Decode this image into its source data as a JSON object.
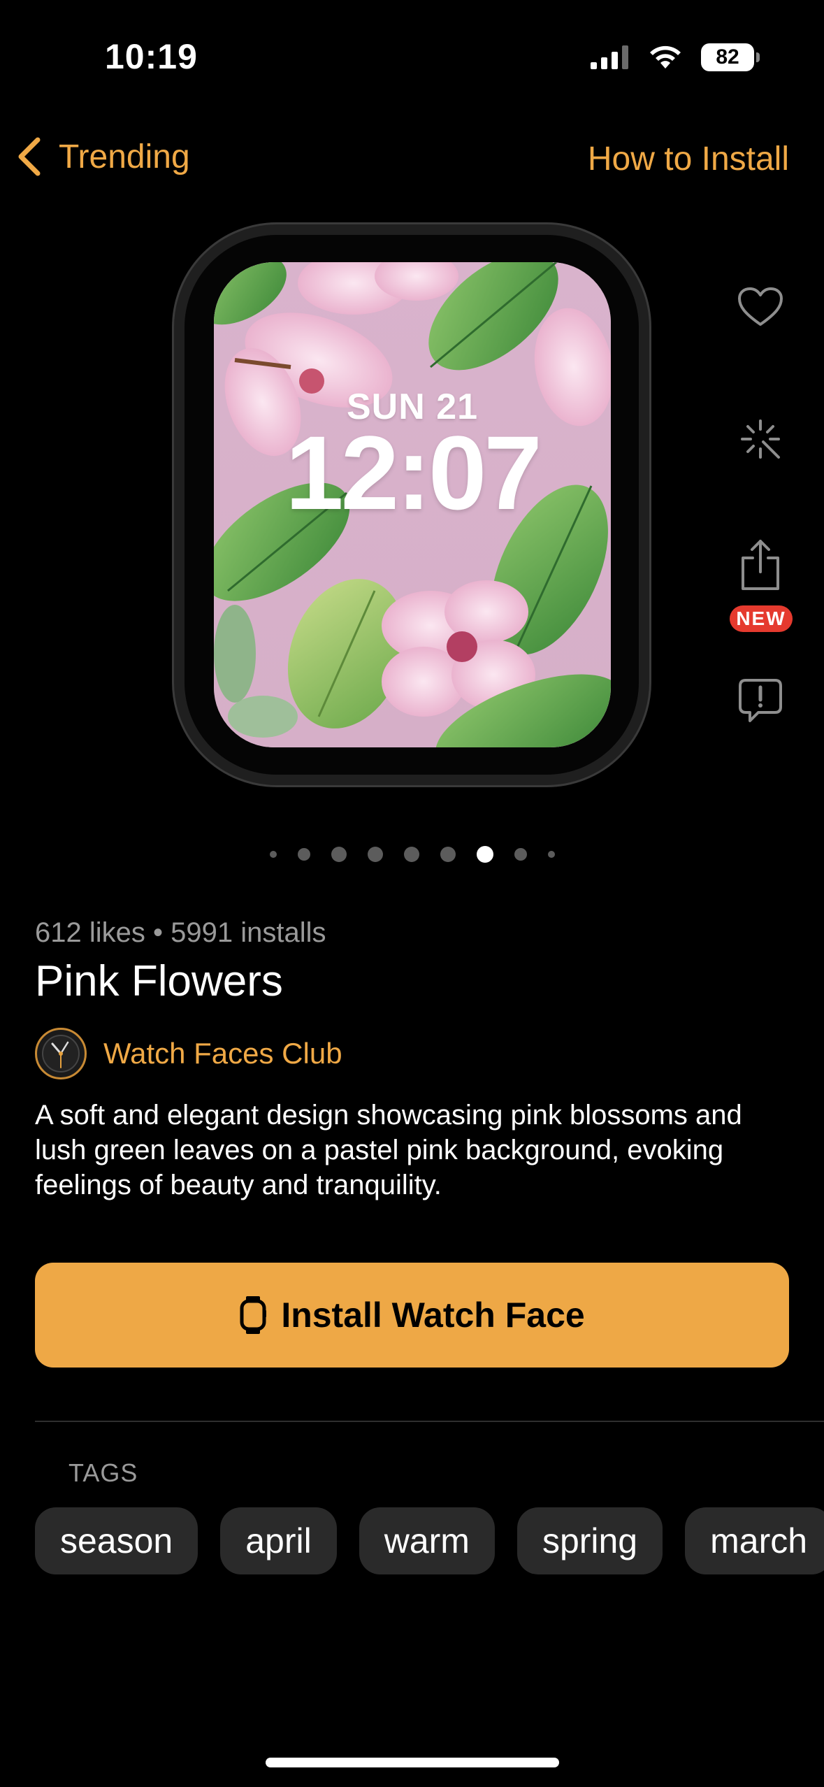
{
  "status_bar": {
    "time": "10:19",
    "battery": "82"
  },
  "nav": {
    "back_label": "Trending",
    "right_label": "How to Install"
  },
  "watch_face": {
    "date": "SUN 21",
    "time": "12:07",
    "screen_color": "#d8b0cb"
  },
  "side_actions": {
    "new_badge": "NEW",
    "icons": [
      "heart-icon",
      "sparkle-icon",
      "share-icon",
      "report-icon"
    ]
  },
  "pagination": {
    "count": 9,
    "active_index": 6
  },
  "face": {
    "stats": "612 likes • 5991 installs",
    "title": "Pink Flowers",
    "author": "Watch Faces Club",
    "description": "A soft and elegant design showcasing pink blossoms and lush green leaves on a pastel pink background, evoking feelings of beauty and tranquility."
  },
  "install_button": {
    "label": "Install Watch Face"
  },
  "tags": {
    "label": "TAGS",
    "items": [
      "season",
      "april",
      "warm",
      "spring",
      "march"
    ]
  },
  "colors": {
    "accent": "#f0a946",
    "button": "#eea846",
    "badge": "#e53a2e",
    "background": "#000000"
  }
}
